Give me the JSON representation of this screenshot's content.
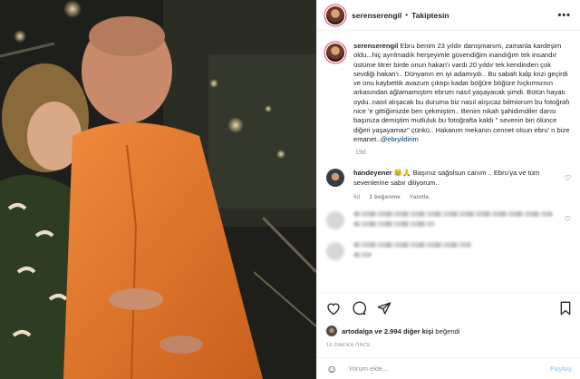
{
  "header": {
    "username": "serenserengil",
    "separator": "•",
    "follow_label": "Takiptesin",
    "more_label": "•••"
  },
  "caption": {
    "username": "serenserengil",
    "text_before": " Ebru benim 23 yıldır danışmanım, zamanla kardeşim oldu...hiç ayrılmadık herşeyimle güvendiğim inandığım tek insandır üstüme titrer birde onun hakan'ı vardı 20 yıldır tek kendinden çok sevdiği hakan'ı.. Dünyanın en iyi adamıydı.. Bu sabah kalp krizi geçirdi ve onu kaybettik avazum çıktıpı kadar böğüre böğüre hıçkımsrnın arkasından ağlamamıştım ebrum nasıl yaşayacak şimdi. Bütün hayatı oydu..nasıl alışacak bu duruma biz nasıl alışıcaz bilmiorum bu fotoğrafı nice 'e gittiğimizde ben çekmiştim.. Benim nikah şahidimdiler dansı başınıza demiştim mutluluk bu fotoğrafta kaldı \" sevenin biri ölünce diğeri yaşayamaz\" çünkü.. Hakanım mekanın cennet olsun ebru' n bize emanet..",
    "mention": "@ebryildirim",
    "time": "19d"
  },
  "comment": {
    "username": "handeyener",
    "text": " 😢🙏 Başınız sağolsun canım .. Ebru'ya ve tüm sevenlerine sabır diliyorum..",
    "time": "6d",
    "likes": "1 beğenme",
    "reply": "Yanıtla",
    "heart": "♡"
  },
  "blurred_comment": {
    "heart": "♡"
  },
  "actions": {
    "like_icon": "heart-outline-icon",
    "comment_icon": "comment-icon",
    "share_icon": "paper-plane-icon",
    "save_icon": "bookmark-icon"
  },
  "likes": {
    "user": "artodalga",
    "rest": " ve 2.994 diğer kişi",
    "suffix": " beğendi"
  },
  "posted_ago": "16 DAKİKA ÖNCE",
  "comment_input": {
    "emoji": "☺",
    "placeholder": "Yorum ekle...",
    "post_label": "Paylaş"
  }
}
